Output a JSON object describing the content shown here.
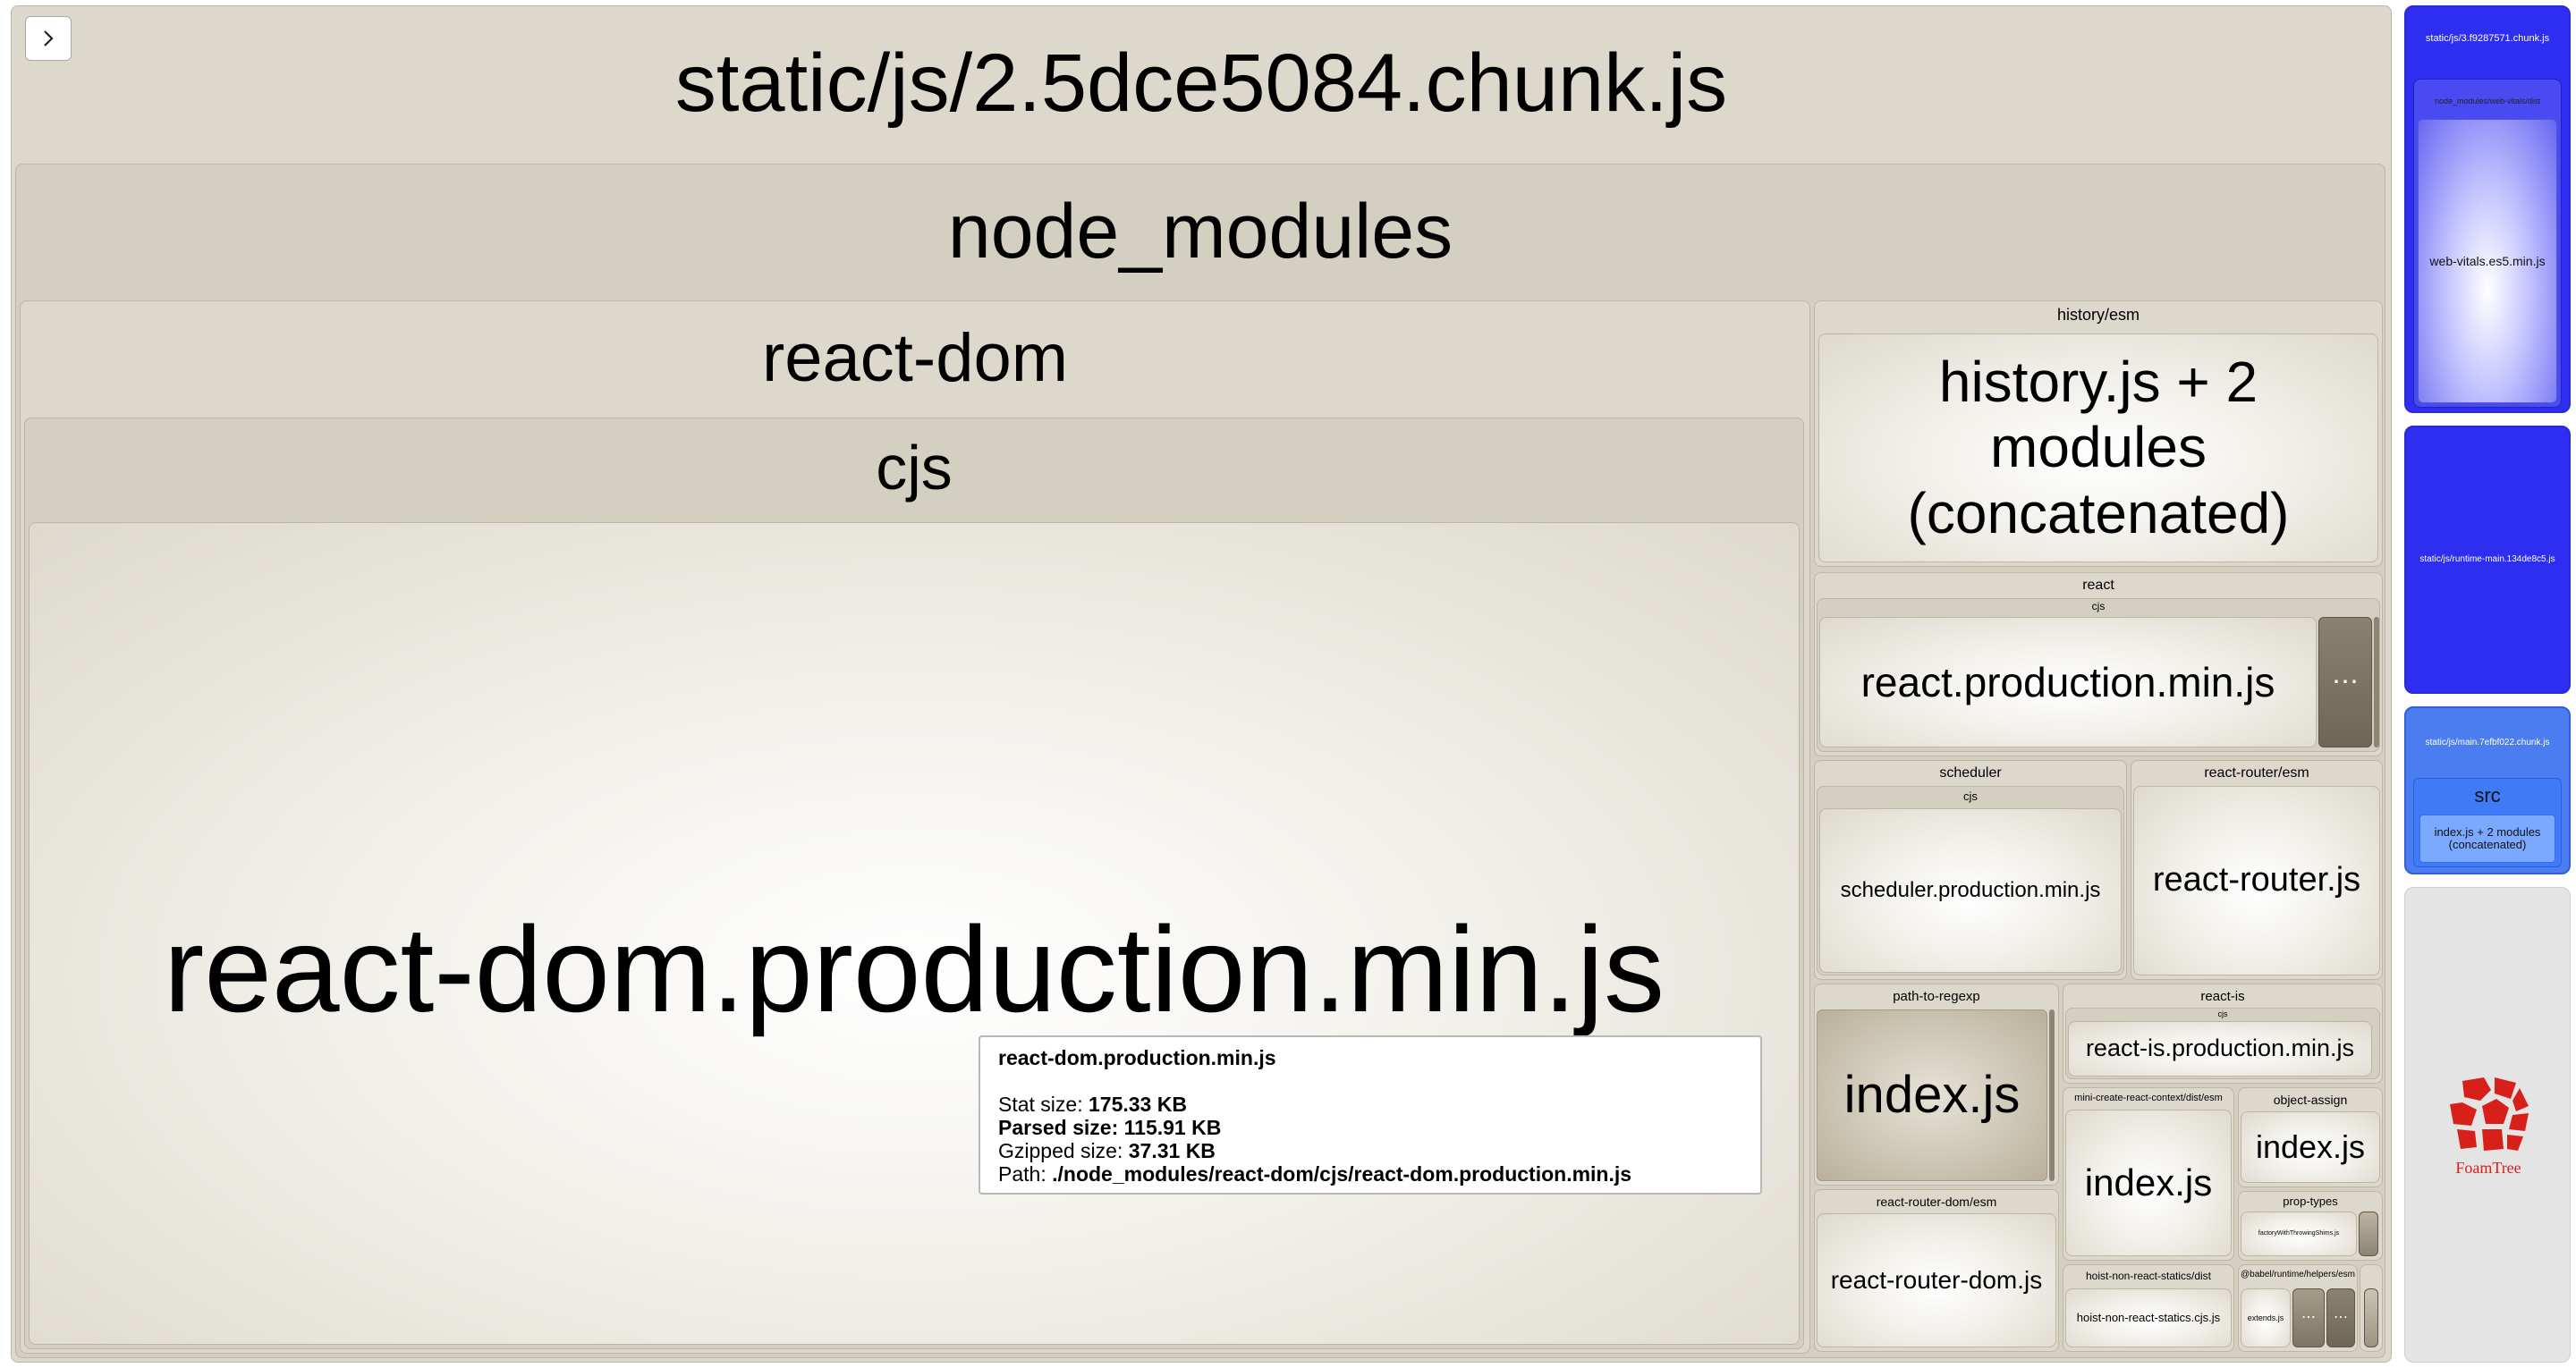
{
  "toggle": {
    "icon": "chevron-right-icon"
  },
  "chunk_main": {
    "label": "static/js/2.5dce5084.chunk.js"
  },
  "node_modules": {
    "label": "node_modules"
  },
  "react_dom": {
    "label": "react-dom",
    "cjs": "cjs",
    "file": "react-dom.production.min.js"
  },
  "history": {
    "label": "history/esm",
    "file": "history.js + 2 modules (concatenated)"
  },
  "react": {
    "label": "react",
    "cjs": "cjs",
    "file": "react.production.min.js",
    "more": "⋯"
  },
  "scheduler": {
    "label": "scheduler",
    "cjs": "cjs",
    "file": "scheduler.production.min.js"
  },
  "react_router": {
    "label": "react-router/esm",
    "file": "react-router.js"
  },
  "path_to_regexp": {
    "label": "path-to-regexp",
    "file": "index.js"
  },
  "react_is": {
    "label": "react-is",
    "cjs": "cjs",
    "file": "react-is.production.min.js"
  },
  "mini_create": {
    "label": "mini-create-react-context/dist/esm",
    "file": "index.js"
  },
  "object_assign": {
    "label": "object-assign",
    "file": "index.js"
  },
  "prop_types": {
    "label": "prop-types",
    "file": "factoryWithThrowingShims.js"
  },
  "react_router_dom": {
    "label": "react-router-dom/esm",
    "file": "react-router-dom.js"
  },
  "hoist": {
    "label": "hoist-non-react-statics/dist",
    "file": "hoist-non-react-statics.cjs.js"
  },
  "babel": {
    "label": "@babel/runtime/helpers/esm",
    "file": "extends.js",
    "more1": "⋯",
    "more2": "⋯"
  },
  "chunk_3": {
    "label": "static/js/3.f9287571.chunk.js",
    "sub": "node_modules/web-vitals/dist",
    "file": "web-vitals.es5.min.js"
  },
  "runtime": {
    "label": "static/js/runtime-main.134de8c5.js"
  },
  "main_chunk": {
    "label": "static/js/main.7efbf022.chunk.js",
    "src": "src",
    "file": "index.js + 2 modules (concatenated)"
  },
  "foamtree": {
    "label": "FoamTree"
  },
  "tooltip": {
    "title": "react-dom.production.min.js",
    "stat_label": "Stat size:",
    "stat_value": "175.33 KB",
    "parsed_label": "Parsed size:",
    "parsed_value": "115.91 KB",
    "gzip_label": "Gzipped size:",
    "gzip_value": "37.31 KB",
    "path_label": "Path:",
    "path_value": "./node_modules/react-dom/cjs/react-dom.production.min.js"
  },
  "colors": {
    "tan": "#dcd8cc",
    "blue": "#2e2ef0",
    "foam_red": "#d7201a"
  }
}
